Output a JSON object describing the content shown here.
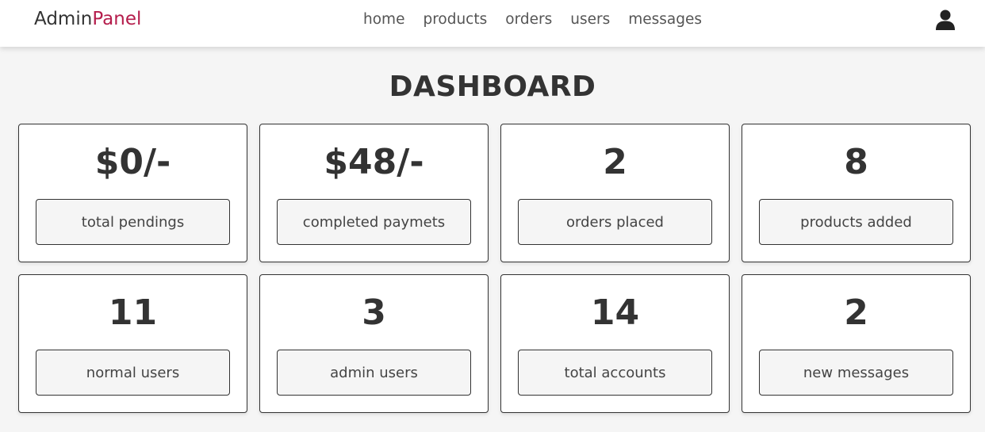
{
  "header": {
    "logo_main": "Admin",
    "logo_accent": "Panel",
    "logo_accent_color": "#b51d4c",
    "nav": [
      "home",
      "products",
      "orders",
      "users",
      "messages"
    ],
    "user_icon": "user-icon"
  },
  "main": {
    "title": "DASHBOARD",
    "cards": [
      {
        "value": "$0/-",
        "label": "total pendings"
      },
      {
        "value": "$48/-",
        "label": "completed paymets"
      },
      {
        "value": "2",
        "label": "orders placed"
      },
      {
        "value": "8",
        "label": "products added"
      },
      {
        "value": "11",
        "label": "normal users"
      },
      {
        "value": "3",
        "label": "admin users"
      },
      {
        "value": "14",
        "label": "total accounts"
      },
      {
        "value": "2",
        "label": "new messages"
      }
    ]
  }
}
